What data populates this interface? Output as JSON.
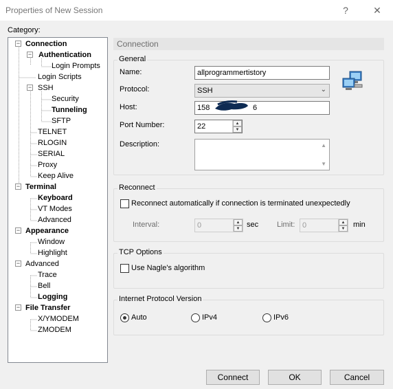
{
  "window": {
    "title": "Properties of New Session",
    "help_glyph": "?",
    "close_glyph": "✕"
  },
  "sidebar": {
    "label": "Category:",
    "items": [
      {
        "label": "Connection"
      },
      {
        "label": "Authentication"
      },
      {
        "label": "Login Prompts"
      },
      {
        "label": "Login Scripts"
      },
      {
        "label": "SSH"
      },
      {
        "label": "Security"
      },
      {
        "label": "Tunneling"
      },
      {
        "label": "SFTP"
      },
      {
        "label": "TELNET"
      },
      {
        "label": "RLOGIN"
      },
      {
        "label": "SERIAL"
      },
      {
        "label": "Proxy"
      },
      {
        "label": "Keep Alive"
      },
      {
        "label": "Terminal"
      },
      {
        "label": "Keyboard"
      },
      {
        "label": "VT Modes"
      },
      {
        "label": "Advanced"
      },
      {
        "label": "Appearance"
      },
      {
        "label": "Window"
      },
      {
        "label": "Highlight"
      },
      {
        "label": "Advanced"
      },
      {
        "label": "Trace"
      },
      {
        "label": "Bell"
      },
      {
        "label": "Logging"
      },
      {
        "label": "File Transfer"
      },
      {
        "label": "X/YMODEM"
      },
      {
        "label": "ZMODEM"
      }
    ]
  },
  "main": {
    "page_title": "Connection",
    "general": {
      "title": "General",
      "name_label": "Name:",
      "name_value": "allprogrammertistory",
      "protocol_label": "Protocol:",
      "protocol_value": "SSH",
      "host_label": "Host:",
      "host_value": "158",
      "host_value_tail": "6",
      "port_label": "Port Number:",
      "port_value": "22",
      "description_label": "Description:",
      "description_value": ""
    },
    "reconnect": {
      "title": "Reconnect",
      "checkbox_label": "Reconnect automatically if connection is terminated unexpectedly",
      "interval_label": "Interval:",
      "interval_value": "0",
      "interval_unit": "sec",
      "limit_label": "Limit:",
      "limit_value": "0",
      "limit_unit": "min"
    },
    "tcp": {
      "title": "TCP Options",
      "nagle_label": "Use Nagle's algorithm"
    },
    "ipv": {
      "title": "Internet Protocol Version",
      "options": [
        {
          "label": "Auto",
          "selected": true
        },
        {
          "label": "IPv4",
          "selected": false
        },
        {
          "label": "IPv6",
          "selected": false
        }
      ]
    }
  },
  "footer": {
    "connect_label": "Connect",
    "ok_label": "OK",
    "cancel_label": "Cancel"
  }
}
